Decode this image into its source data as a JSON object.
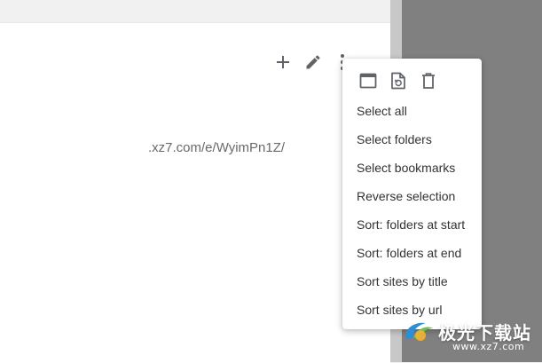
{
  "toolbar": {
    "add_icon": "plus-icon",
    "edit_icon": "pencil-icon",
    "more_icon": "more-vert-icon"
  },
  "content": {
    "url_text": ".xz7.com/e/WyimPn1Z/"
  },
  "menu": {
    "icons": [
      "open-in-window-icon",
      "restore-file-icon",
      "delete-icon"
    ],
    "items": [
      {
        "label": "Select all"
      },
      {
        "label": "Select folders"
      },
      {
        "label": "Select bookmarks"
      },
      {
        "label": "Reverse selection"
      },
      {
        "label": "Sort: folders at start"
      },
      {
        "label": "Sort: folders at end"
      },
      {
        "label": "Sort sites by title"
      },
      {
        "label": "Sort sites by url"
      }
    ]
  },
  "watermark": {
    "brand": "极光下载站",
    "site": "www.xz7.com"
  },
  "colors": {
    "icon": "#5f6368",
    "text": "#333333",
    "url": "#6a6a6a",
    "dark_pane": "#808080",
    "scrollbar": "#c8c8c8"
  }
}
